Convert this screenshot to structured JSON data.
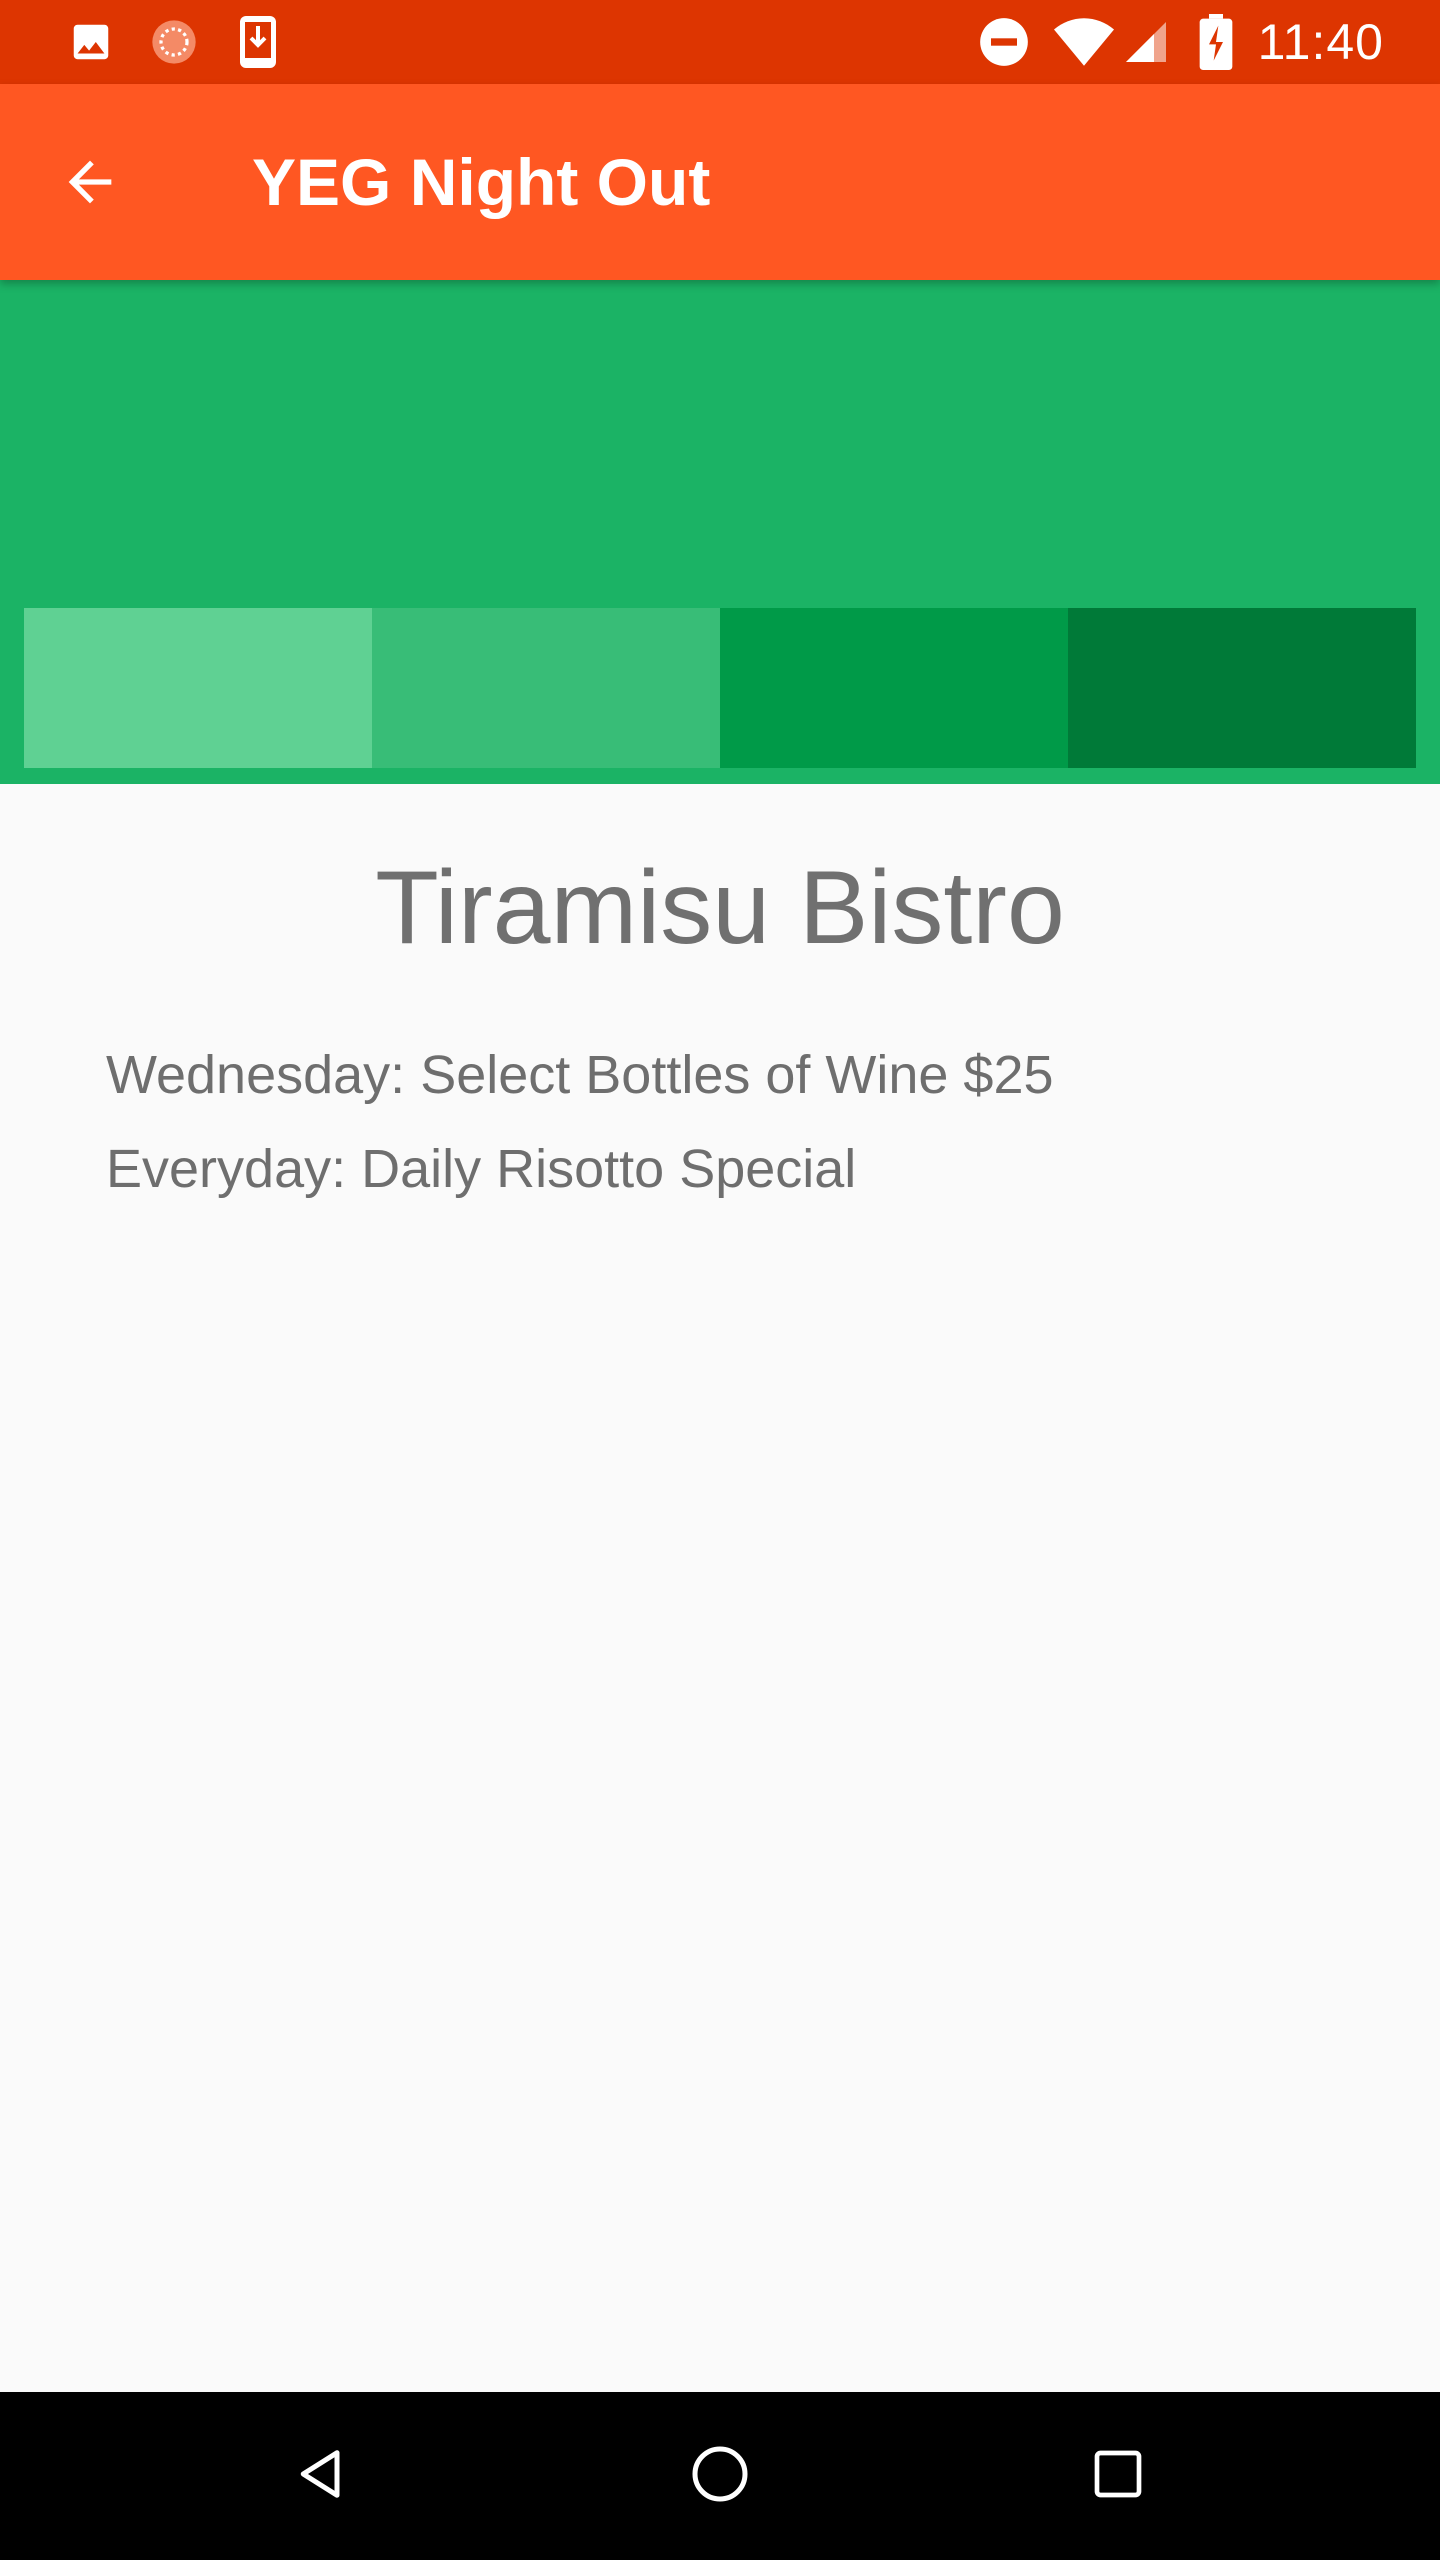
{
  "status_bar": {
    "time": "11:40",
    "left_icons": [
      "image-icon",
      "spinner-icon",
      "download-icon"
    ],
    "right_icons": [
      "do-not-disturb-icon",
      "wifi-icon",
      "signal-icon",
      "battery-charging-icon"
    ],
    "color": "#dd3501"
  },
  "app_bar": {
    "title": "YEG Night Out",
    "back_icon": "arrow-back-icon",
    "color": "#ff5722"
  },
  "hero": {
    "background": "#1bb365",
    "swatches": [
      "#5fd193",
      "#38bd77",
      "#009a48",
      "#007a38"
    ]
  },
  "venue": {
    "name": "Tiramisu Bistro",
    "specials": [
      "Wednesday: Select Bottles of Wine $25",
      "Everyday: Daily Risotto Special"
    ]
  },
  "nav_bar": {
    "icons": [
      "nav-back-icon",
      "nav-home-icon",
      "nav-recents-icon"
    ]
  }
}
